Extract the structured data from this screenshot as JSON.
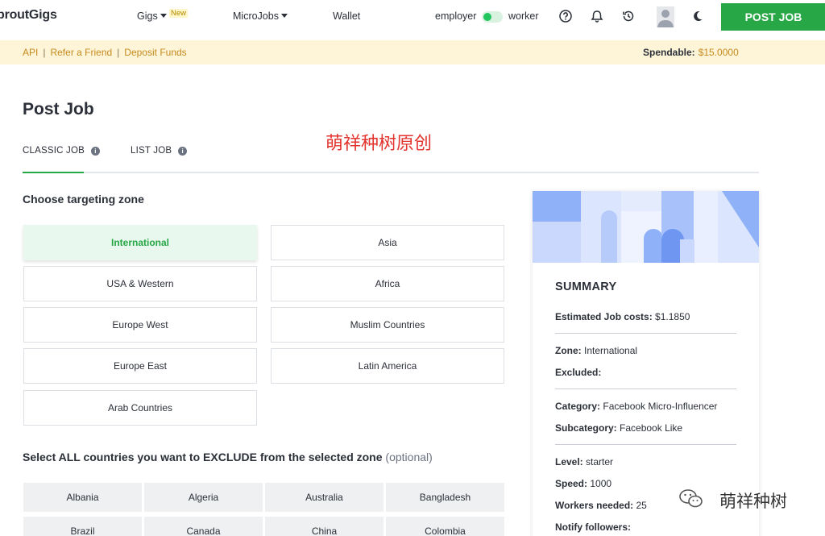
{
  "nav": {
    "logo": "proutGigs",
    "gigs": "Gigs",
    "new_badge": "New",
    "microjobs": "MicroJobs",
    "wallet": "Wallet",
    "employer": "employer",
    "worker": "worker",
    "post_job": "POST JOB",
    "accent": "#27a745"
  },
  "subbar": {
    "links": [
      "API",
      "Refer a Friend",
      "Deposit Funds"
    ],
    "spendable_label": "Spendable:",
    "spendable_value": "$15.0000"
  },
  "page": {
    "title": "Post Job",
    "watermark": "萌祥种树原创",
    "tabs": [
      "CLASSIC JOB",
      "LIST JOB"
    ],
    "zone_heading": "Choose targeting zone",
    "zones": [
      "International",
      "Asia",
      "USA & Western",
      "Africa",
      "Europe West",
      "Muslim Countries",
      "Europe East",
      "Latin America",
      "Arab Countries"
    ],
    "active_zone": "International",
    "exclude_heading": "Select ALL countries you want to EXCLUDE from the selected zone",
    "exclude_optional": "(optional)",
    "countries": [
      "Albania",
      "Algeria",
      "Australia",
      "Bangladesh",
      "Brazil",
      "Canada",
      "China",
      "Colombia"
    ]
  },
  "summary": {
    "title": "SUMMARY",
    "cost_label": "Estimated Job costs:",
    "cost_value": "$1.1850",
    "zone_label": "Zone:",
    "zone_value": "International",
    "excluded_label": "Excluded:",
    "category_label": "Category:",
    "category_value": "Facebook Micro-Influencer",
    "subcategory_label": "Subcategory:",
    "subcategory_value": "Facebook Like",
    "level_label": "Level:",
    "level_value": "starter",
    "speed_label": "Speed:",
    "speed_value": "1000",
    "workers_label": "Workers needed:",
    "workers_value": "25",
    "notify_label": "Notify followers:"
  },
  "wechat_mark": "萌祥种树"
}
